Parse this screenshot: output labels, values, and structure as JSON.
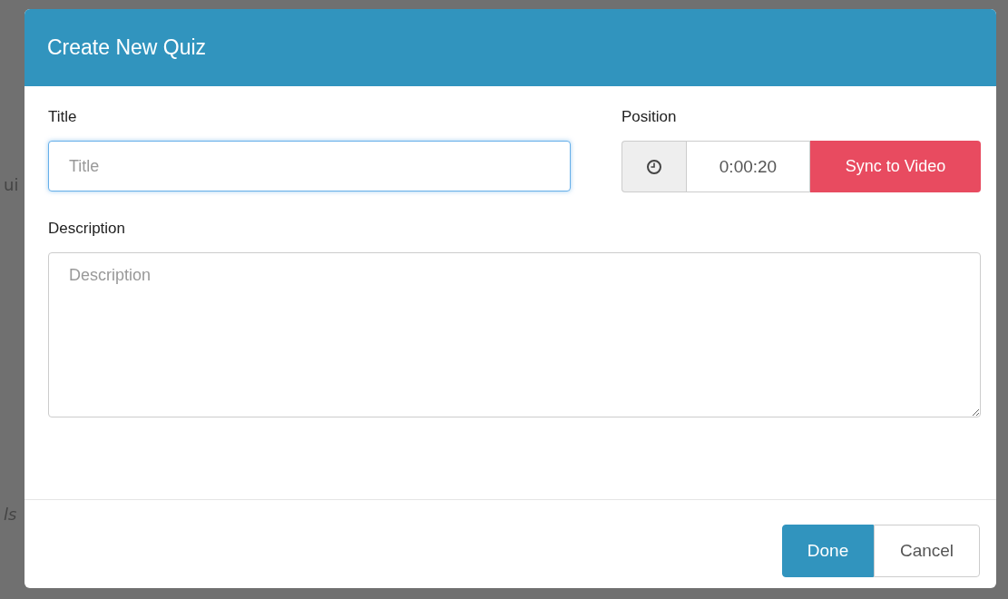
{
  "backdrop": {
    "fragments": [
      "ui",
      "ls"
    ]
  },
  "dialog": {
    "title": "Create New Quiz",
    "title_field": {
      "label": "Title",
      "placeholder": "Title",
      "focused": true
    },
    "position": {
      "label": "Position",
      "value": "0:00:20",
      "sync_button": "Sync to Video"
    },
    "description": {
      "label": "Description",
      "placeholder": "Description"
    },
    "buttons": [
      {
        "label": "Done",
        "kind": "primary"
      },
      {
        "label": "Cancel",
        "kind": "secondary"
      }
    ]
  }
}
